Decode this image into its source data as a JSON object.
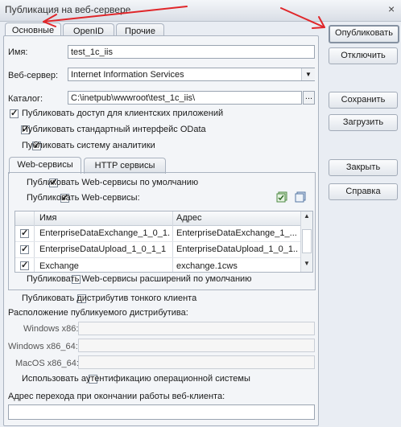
{
  "window": {
    "title": "Публикация на веб-сервере",
    "close_label": "×"
  },
  "tabs": [
    "Основные",
    "OpenID",
    "Прочие"
  ],
  "form": {
    "name_label": "Имя:",
    "name_value": "test_1c_iis",
    "webserver_label": "Веб-сервер:",
    "webserver_value": "Internet Information Services",
    "catalog_label": "Каталог:",
    "catalog_value": "C:\\inetpub\\wwwroot\\test_1c_iis\\",
    "catalog_browse": "...",
    "checks": [
      {
        "label": "Публиковать доступ для клиентских приложений",
        "checked": true
      },
      {
        "label": "Публиковать стандартный интерфейс OData",
        "checked": true
      },
      {
        "label": "Публиковать систему аналитики",
        "checked": true
      }
    ]
  },
  "inner_tabs": [
    "Web-сервисы",
    "HTTP сервисы"
  ],
  "ws": {
    "default_label": "Публиковать Web-сервисы по умолчанию",
    "publish_label": "Публиковать Web-сервисы:",
    "columns": [
      "Имя",
      "Адрес"
    ],
    "rows": [
      {
        "checked": true,
        "name": "EnterpriseDataExchange_1_0_1...",
        "address": "EnterpriseDataExchange_1_..."
      },
      {
        "checked": true,
        "name": "EnterpriseDataUpload_1_0_1_1",
        "address": "EnterpriseDataUpload_1_0_1..."
      },
      {
        "checked": true,
        "name": "Exchange",
        "address": "exchange.1cws"
      }
    ],
    "extensions_label": "Публиковать Web-сервисы расширений по умолчанию"
  },
  "thin": {
    "publish_label": "Публиковать дистрибутив тонкого клиента",
    "location_label": "Расположение публикуемого дистрибутива:",
    "win86_label": "Windows x86:",
    "win64_label": "Windows x86_64:",
    "mac_label": "MacOS x86_64:"
  },
  "os_auth_label": "Использовать аутентификацию операционной системы",
  "exit_url_label": "Адрес перехода при окончании работы веб-клиента:",
  "buttons": {
    "publish": "Опубликовать",
    "unpublish": "Отключить",
    "save": "Сохранить",
    "load": "Загрузить",
    "close": "Закрыть",
    "help": "Справка"
  },
  "colors": {
    "annotation_arrow": "#e0262a",
    "window_bg": "#e9edf3"
  }
}
